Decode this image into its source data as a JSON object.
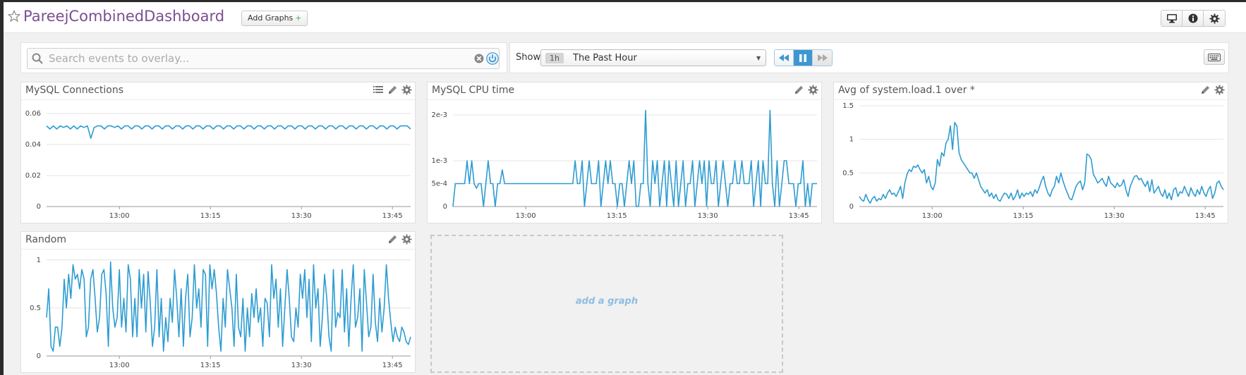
{
  "header": {
    "title": "PareejCombinedDashboard",
    "add_graphs_label": "Add Graphs",
    "add_graphs_plus": "+",
    "buttons": [
      "monitor-icon",
      "info-icon",
      "gear-icon"
    ]
  },
  "search": {
    "placeholder": "Search events to overlay..."
  },
  "time": {
    "show_label": "Show",
    "chip": "1h",
    "selected": "The Past Hour"
  },
  "colors": {
    "accent": "#3d97d1",
    "line": "#2e9cd1",
    "title": "#7a4f8f",
    "plus": "#4caf50"
  },
  "widgets": [
    {
      "title": "MySQL Connections",
      "tools": [
        "list-icon",
        "pencil-icon",
        "gear-icon"
      ]
    },
    {
      "title": "MySQL CPU time",
      "tools": [
        "pencil-icon",
        "gear-icon"
      ]
    },
    {
      "title": "Avg of system.load.1 over *",
      "tools": [
        "pencil-icon",
        "gear-icon"
      ]
    },
    {
      "title": "Random",
      "tools": [
        "pencil-icon",
        "gear-icon"
      ]
    }
  ],
  "placeholder": {
    "label": "add a graph"
  },
  "chart_data": [
    {
      "type": "line",
      "title": "MySQL Connections",
      "x_ticks": [
        "13:00",
        "13:15",
        "13:30",
        "13:45"
      ],
      "y_ticks": [
        "0",
        "0.02",
        "0.04",
        "0.06"
      ],
      "ylim": [
        0,
        0.065
      ],
      "xlim": [
        0,
        60
      ],
      "grid": true,
      "series": [
        {
          "values": [
            0.052,
            0.05,
            0.052,
            0.05,
            0.052,
            0.051,
            0.052,
            0.05,
            0.052,
            0.05,
            0.052,
            0.051,
            0.052,
            0.044,
            0.051,
            0.052,
            0.052,
            0.05,
            0.052,
            0.052,
            0.051,
            0.052,
            0.05,
            0.052,
            0.052,
            0.05,
            0.052,
            0.052,
            0.05,
            0.052,
            0.052,
            0.05,
            0.052,
            0.052,
            0.05,
            0.052,
            0.052,
            0.05,
            0.052,
            0.052,
            0.05,
            0.052,
            0.052,
            0.05,
            0.052,
            0.052,
            0.05,
            0.052,
            0.052,
            0.05,
            0.052,
            0.052,
            0.05,
            0.052,
            0.052,
            0.05,
            0.052,
            0.052,
            0.05,
            0.052,
            0.052,
            0.05,
            0.052,
            0.052,
            0.05,
            0.052,
            0.052,
            0.05,
            0.052,
            0.052,
            0.05,
            0.052,
            0.052,
            0.05,
            0.052,
            0.052,
            0.05,
            0.052,
            0.052,
            0.05,
            0.052,
            0.052,
            0.05,
            0.052,
            0.052,
            0.05,
            0.052,
            0.052,
            0.05,
            0.052,
            0.052,
            0.05,
            0.052,
            0.052,
            0.05,
            0.052,
            0.052,
            0.05,
            0.052,
            0.052,
            0.05,
            0.052,
            0.052,
            0.05,
            0.052,
            0.052,
            0.052,
            0.05
          ]
        }
      ]
    },
    {
      "type": "line",
      "title": "MySQL CPU time",
      "x_ticks": [
        "13:00",
        "13:15",
        "13:30",
        "13:45"
      ],
      "y_ticks": [
        "0",
        "5e-4",
        "1e-3",
        "2e-3"
      ],
      "y_tick_values": [
        0,
        0.0005,
        0.001,
        0.002
      ],
      "ylim": [
        0,
        0.0022
      ],
      "xlim": [
        0,
        60
      ],
      "grid": true,
      "series": [
        {
          "values": [
            0,
            0.0005,
            0.0005,
            0.0005,
            0.0005,
            0.0005,
            0.001,
            0.0005,
            0.001,
            0.0005,
            0.0004,
            0.0005,
            0.0005,
            0,
            0.0005,
            0.001,
            0.0005,
            0.0005,
            0,
            0.0005,
            0.0005,
            0.0008,
            0.0005,
            0.0005,
            0.0005,
            0.0005,
            0.0005,
            0.0005,
            0.0005,
            0.0005,
            0.0005,
            0.0005,
            0.0005,
            0.0005,
            0.0005,
            0.0005,
            0.0005,
            0.0005,
            0.0005,
            0.0005,
            0.0005,
            0.0005,
            0.0005,
            0.0005,
            0.0005,
            0.0005,
            0.0005,
            0.0005,
            0.0005,
            0.0005,
            0.0005,
            0.0005,
            0.001,
            0.0005,
            0.0005,
            0.001,
            0,
            0.0005,
            0.001,
            0.0005,
            0.0005,
            0.0005,
            0.001,
            0,
            0.0005,
            0.001,
            0.0005,
            0.001,
            0.0005,
            0.0005,
            0,
            0.0005,
            0.0005,
            0,
            0.0005,
            0.001,
            0.0005,
            0.001,
            0,
            0,
            0.0005,
            0.0005,
            0.0021,
            0.0005,
            0,
            0.001,
            0.0005,
            0.001,
            0,
            0.0005,
            0.001,
            0,
            0.001,
            0.0005,
            0,
            0.001,
            0,
            0.0005,
            0.001,
            0,
            0.0005,
            0.0005,
            0.001,
            0,
            0.0005,
            0.001,
            0.0005,
            0.001,
            0,
            0.001,
            0.0005,
            0.0005,
            0.001,
            0,
            0.0005,
            0.001,
            0.0005,
            0,
            0.0005,
            0.0005,
            0.001,
            0.0005,
            0.0005,
            0.001,
            0.0005,
            0.0005,
            0.0005,
            0.001,
            0,
            0.0005,
            0.001,
            0,
            0.001,
            0.0005,
            0.0005,
            0.0021,
            0.0005,
            0,
            0.001,
            0,
            0.0005,
            0.001,
            0.001,
            0.0005,
            0.0005,
            0.0005,
            0,
            0.0005,
            0.0005,
            0.001,
            0,
            0.0005,
            0,
            0.0005,
            0.0005,
            0.0005
          ]
        }
      ]
    },
    {
      "type": "line",
      "title": "Avg of system.load.1 over *",
      "x_ticks": [
        "13:00",
        "13:15",
        "13:30",
        "13:45"
      ],
      "y_ticks": [
        "0",
        "0.5",
        "1",
        "1.5"
      ],
      "ylim": [
        0,
        1.5
      ],
      "xlim": [
        0,
        60
      ],
      "grid": true,
      "series": [
        {
          "values": [
            0.15,
            0.1,
            0.08,
            0.18,
            0.1,
            0.05,
            0.12,
            0.15,
            0.08,
            0.12,
            0.1,
            0.18,
            0.12,
            0.2,
            0.25,
            0.18,
            0.2,
            0.15,
            0.22,
            0.3,
            0.12,
            0.35,
            0.48,
            0.55,
            0.52,
            0.6,
            0.58,
            0.62,
            0.55,
            0.5,
            0.55,
            0.35,
            0.45,
            0.3,
            0.25,
            0.35,
            0.7,
            0.6,
            0.8,
            0.75,
            0.95,
            1.0,
            1.2,
            0.85,
            1.25,
            1.2,
            0.8,
            0.7,
            0.65,
            0.6,
            0.55,
            0.5,
            0.5,
            0.42,
            0.5,
            0.4,
            0.3,
            0.25,
            0.2,
            0.25,
            0.15,
            0.2,
            0.12,
            0.18,
            0.1,
            0.08,
            0.15,
            0.2,
            0.18,
            0.12,
            0.2,
            0.1,
            0.15,
            0.25,
            0.12,
            0.2,
            0.15,
            0.2,
            0.18,
            0.22,
            0.15,
            0.25,
            0.2,
            0.28,
            0.38,
            0.45,
            0.3,
            0.2,
            0.15,
            0.25,
            0.3,
            0.45,
            0.35,
            0.5,
            0.38,
            0.28,
            0.2,
            0.12,
            0.1,
            0.2,
            0.3,
            0.35,
            0.38,
            0.25,
            0.35,
            0.78,
            0.76,
            0.7,
            0.48,
            0.42,
            0.35,
            0.38,
            0.42,
            0.35,
            0.3,
            0.45,
            0.35,
            0.32,
            0.28,
            0.35,
            0.3,
            0.32,
            0.4,
            0.25,
            0.15,
            0.3,
            0.38,
            0.45,
            0.46,
            0.4,
            0.42,
            0.35,
            0.3,
            0.38,
            0.22,
            0.4,
            0.2,
            0.25,
            0.3,
            0.2,
            0.15,
            0.25,
            0.12,
            0.2,
            0.1,
            0.25,
            0.28,
            0.15,
            0.22,
            0.2,
            0.3,
            0.22,
            0.15,
            0.28,
            0.2,
            0.15,
            0.25,
            0.18,
            0.3,
            0.2,
            0.15,
            0.25,
            0.3,
            0.12,
            0.2,
            0.35,
            0.38,
            0.3,
            0.25
          ]
        }
      ]
    },
    {
      "type": "line",
      "title": "Random",
      "x_ticks": [
        "13:00",
        "13:15",
        "13:30",
        "13:45"
      ],
      "y_ticks": [
        "0",
        "0.5",
        "1"
      ],
      "ylim": [
        0,
        1.05
      ],
      "xlim": [
        0,
        60
      ],
      "grid": true,
      "series": [
        {
          "values": [
            0.4,
            0.7,
            0.1,
            0.05,
            0.3,
            0.3,
            0.1,
            0.3,
            0.8,
            0.5,
            0.85,
            0.6,
            0.95,
            0.8,
            0.85,
            0.7,
            0.9,
            0.8,
            0.2,
            0.3,
            0.8,
            0.9,
            0.6,
            0.25,
            0.4,
            0.85,
            0.9,
            0.65,
            0.1,
            0.98,
            0.5,
            0.3,
            0.4,
            0.9,
            0.3,
            0.6,
            0.25,
            0.95,
            0.8,
            0.2,
            0.6,
            0.2,
            0.9,
            0.5,
            0.85,
            0.25,
            0.88,
            0.55,
            0.1,
            0.3,
            0.9,
            0.2,
            0.6,
            0.05,
            0.4,
            0.15,
            0.6,
            0.35,
            0.9,
            0.6,
            0.2,
            0.7,
            0.1,
            0.6,
            0.85,
            0.2,
            0.4,
            0.95,
            0.5,
            0.7,
            0.3,
            0.9,
            0.85,
            0.1,
            0.95,
            0.7,
            0.9,
            0.65,
            0.3,
            0.05,
            0.6,
            0.3,
            0.9,
            0.7,
            0.5,
            0.1,
            0.85,
            0.3,
            0.2,
            0.6,
            0.05,
            0.5,
            0.2,
            0.65,
            0.4,
            0.7,
            0.35,
            0.5,
            0.1,
            0.6,
            0.55,
            0.2,
            0.95,
            0.6,
            0.8,
            0.3,
            0.7,
            0.1,
            0.5,
            0.9,
            0.6,
            0.2,
            0.15,
            0.5,
            0.3,
            0.85,
            0.6,
            0.9,
            0.4,
            0.8,
            0.15,
            0.95,
            0.5,
            0.7,
            0.1,
            0.4,
            0.85,
            0.6,
            0.2,
            0.05,
            0.9,
            0.3,
            0.45,
            0.4,
            0.9,
            0.25,
            0.7,
            0.1,
            0.6,
            0.95,
            0.3,
            0.4,
            0.7,
            0.05,
            0.9,
            0.55,
            0.2,
            0.3,
            0.85,
            0.35,
            0.15,
            0.6,
            0.25,
            0.5,
            0.95,
            0.6,
            0.35,
            0.15,
            0.3,
            0.2,
            0.15,
            0.3,
            0.25,
            0.15,
            0.12,
            0.2
          ]
        }
      ]
    }
  ]
}
